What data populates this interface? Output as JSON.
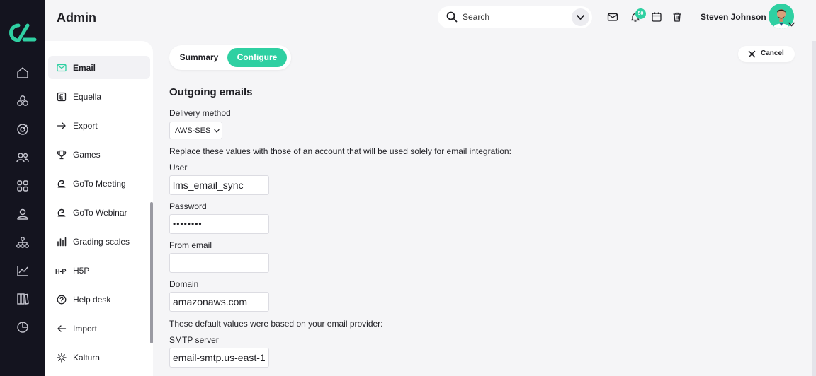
{
  "app": {
    "title": "Admin"
  },
  "header": {
    "search_label": "Search",
    "notification_count": "50",
    "user_name": "Steven Johnson"
  },
  "rail": {
    "icons": [
      "home-icon",
      "modules-icon",
      "target-icon",
      "users-icon",
      "apps-icon",
      "person-icon",
      "hierarchy-icon",
      "analytics-icon",
      "library-icon",
      "pie-chart-icon"
    ]
  },
  "sidebar": {
    "items": [
      {
        "label": "Email",
        "icon": "mail-icon",
        "active": true
      },
      {
        "label": "Equella",
        "icon": "equella-icon",
        "active": false
      },
      {
        "label": "Export",
        "icon": "arrow-right-icon",
        "active": false
      },
      {
        "label": "Games",
        "icon": "trophy-icon",
        "active": false
      },
      {
        "label": "GoTo Meeting",
        "icon": "goto-icon",
        "active": false
      },
      {
        "label": "GoTo Webinar",
        "icon": "goto-icon",
        "active": false
      },
      {
        "label": "Grading scales",
        "icon": "bar-chart-icon",
        "active": false
      },
      {
        "label": "H5P",
        "icon": "h5p-icon",
        "active": false
      },
      {
        "label": "Help desk",
        "icon": "help-icon",
        "active": false
      },
      {
        "label": "Import",
        "icon": "arrow-left-icon",
        "active": false
      },
      {
        "label": "Kaltura",
        "icon": "kaltura-icon",
        "active": false
      }
    ]
  },
  "tabs": {
    "summary": "Summary",
    "configure": "Configure",
    "active": "Configure"
  },
  "cancel_label": "Cancel",
  "form": {
    "title": "Outgoing emails",
    "delivery_method_label": "Delivery method",
    "delivery_method_value": "AWS-SES",
    "replace_note": "Replace these values with those of an account that will be used solely for email integration:",
    "user_label": "User",
    "user_value": "lms_email_sync",
    "password_label": "Password",
    "password_value": "••••••••",
    "from_email_label": "From email",
    "from_email_value": "",
    "domain_label": "Domain",
    "domain_value": "amazonaws.com",
    "default_note": "These default values were based on your email provider:",
    "smtp_label": "SMTP server",
    "smtp_value": "email-smtp.us-east-1"
  },
  "colors": {
    "accent": "#2fd0a2",
    "rail": "#14141f",
    "background": "#f5f5f7"
  }
}
